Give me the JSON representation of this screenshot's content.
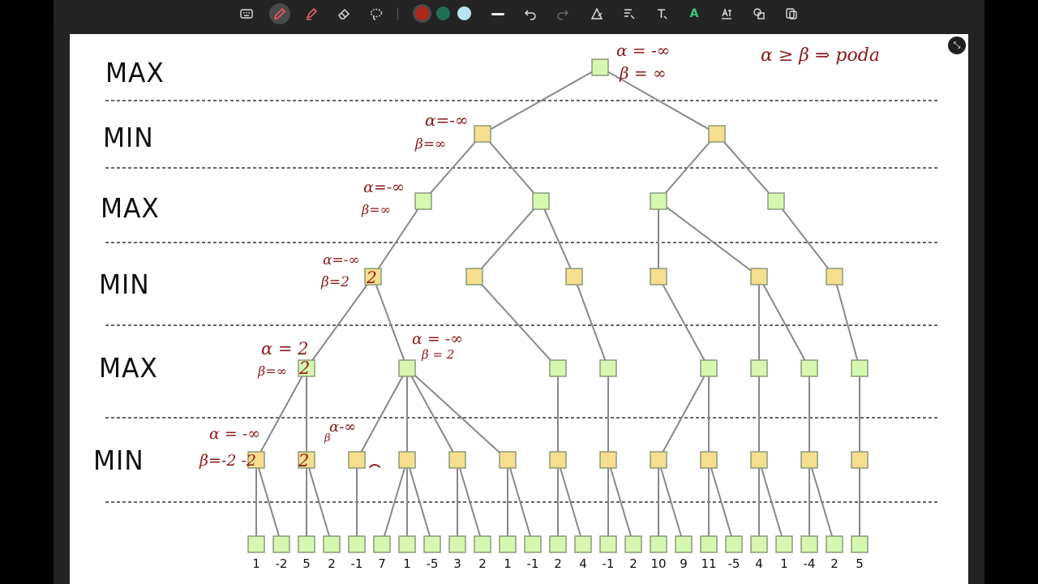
{
  "colors": {
    "background": "#000000",
    "toolbar": "#242424",
    "canvas": "#ffffff",
    "max_node_fill": "#d6f7b0",
    "min_node_fill": "#f5df8e",
    "node_stroke": "#8a9a7a",
    "edge": "#888888",
    "annotation": "#8b1a1a",
    "swatch_red": "#b2281b",
    "swatch_green": "#1f6f53",
    "swatch_lightblue": "#b9e3f5"
  },
  "toolbar": {
    "icons": [
      "keyboard-icon",
      "pen-icon",
      "highlighter-icon",
      "eraser-icon",
      "lasso-icon",
      "color-red",
      "color-green",
      "color-lightblue",
      "line-width-icon",
      "undo-icon",
      "redo-icon",
      "shape-icon",
      "text-format-icon",
      "text-tool-icon",
      "ai-icon",
      "ocr-icon",
      "shapes-icon",
      "copy-icon"
    ]
  },
  "levels": [
    "MAX",
    "MIN",
    "MAX",
    "MIN",
    "MAX",
    "MIN"
  ],
  "annotations": {
    "root_alpha": "α = -∞",
    "root_beta": "β = ∞",
    "rule": "α ≥ β ⇒ poda",
    "min1_alpha": "α=-∞",
    "min1_beta": "β=∞",
    "max2_alpha": "α=-∞",
    "max2_beta": "β=∞",
    "min3_alpha": "α=-∞",
    "min3_beta": "β=2",
    "min3_value": "2",
    "max4_alpha": "α = 2",
    "max4_beta": "β=∞",
    "max4_value": "2",
    "max4b_alpha": "α = -∞",
    "max4b_beta": "β = 2",
    "min5_alpha": "α = -∞",
    "min5_beta": "β=-2 -2",
    "min5_value": "2",
    "min5b_value": "2",
    "min5c_alpha": "α-∞",
    "min5c_beta": "β"
  },
  "leaves": [
    "1",
    "-2",
    "5",
    "2",
    "-1",
    "7",
    "1",
    "-5",
    "3",
    "2",
    "1",
    "-1",
    "2",
    "4",
    "-1",
    "2",
    "10",
    "9",
    "11",
    "-5",
    "4",
    "1",
    "-4",
    "2",
    "5"
  ]
}
